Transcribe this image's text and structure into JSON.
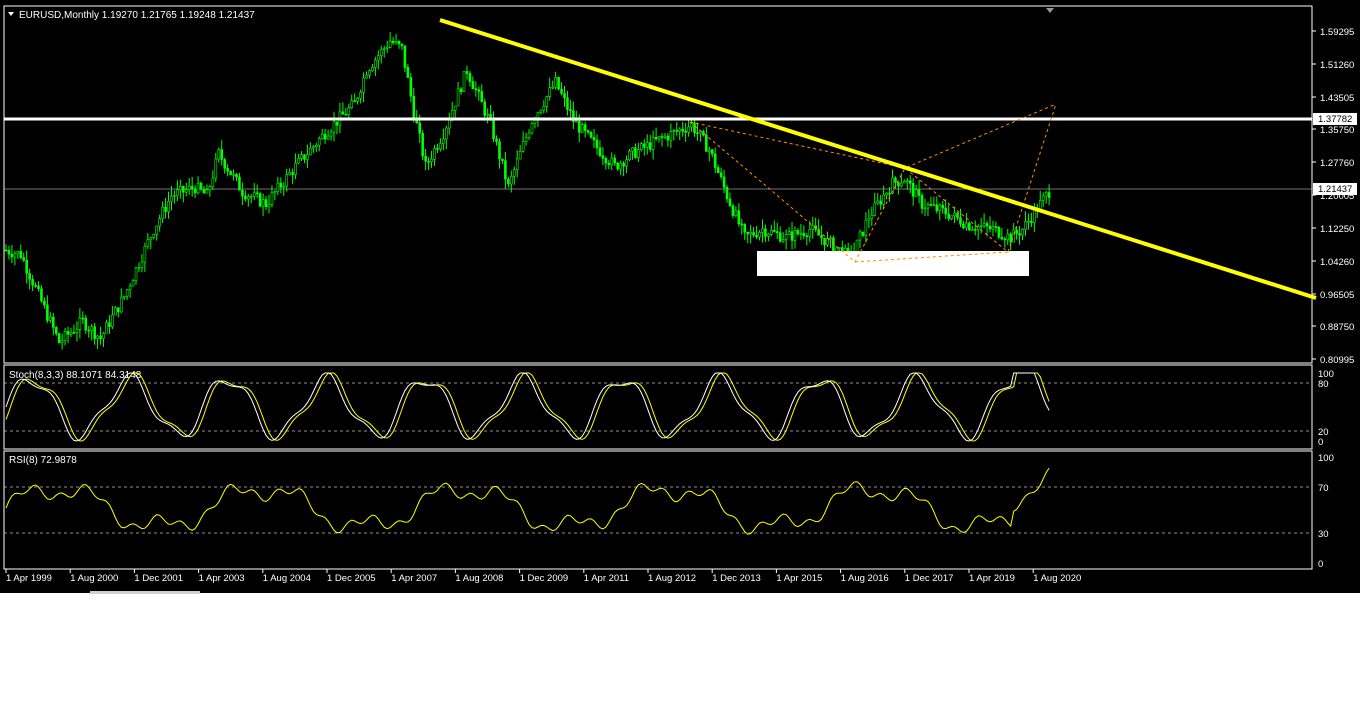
{
  "window": {
    "symbol_header": "EURUSD,Monthly  1.19270 1.21765 1.19248 1.21437",
    "dropdown_arrow": "triangle-down-icon"
  },
  "colors": {
    "background": "#000000",
    "candle": "#00ff00",
    "trendline": "#ffff00",
    "horizontal_level": "#ffffff",
    "stoch_main": "#ffffff",
    "stoch_signal": "#ffff00",
    "rsi_line": "#ffff00",
    "pattern_lines": "#ff8c00",
    "bid_line": "#9a9a9a",
    "zone_box": "#ffffff"
  },
  "price_panel": {
    "price_labels": [
      "1.59295",
      "1.51260",
      "1.43505",
      "1.35750",
      "1.27760",
      "1.20005",
      "1.12250",
      "1.04260",
      "0.96505",
      "0.88750",
      "0.80995"
    ],
    "current_price": "1.21437",
    "level_price": "1.37782"
  },
  "stoch_panel": {
    "header": "Stoch(8,3,3) 88.1071 84.3148",
    "levels": [
      "100",
      "80",
      "20",
      "0"
    ]
  },
  "rsi_panel": {
    "header": "RSI(8) 72.9878",
    "levels": [
      "100",
      "70",
      "30",
      "0"
    ]
  },
  "time_axis": {
    "labels": [
      "1 Apr 1999",
      "1 Aug 2000",
      "1 Dec 2001",
      "1 Apr 2003",
      "1 Aug 2004",
      "1 Dec 2005",
      "1 Apr 2007",
      "1 Aug 2008",
      "1 Dec 2009",
      "1 Apr 2011",
      "1 Aug 2012",
      "1 Dec 2013",
      "1 Apr 2015",
      "1 Aug 2016",
      "1 Dec 2017",
      "1 Apr 2019",
      "1 Aug 2020"
    ]
  },
  "chart_data": {
    "type": "candlestick",
    "symbol": "EURUSD",
    "timeframe": "Monthly",
    "ohlc_last": {
      "open": 1.1927,
      "high": 1.21765,
      "low": 1.19248,
      "close": 1.21437
    },
    "ylim": [
      0.80995,
      1.59295
    ],
    "approx_close_path": [
      {
        "date": "1999-04",
        "close": 1.07
      },
      {
        "date": "2000-10",
        "close": 0.85
      },
      {
        "date": "2001-12",
        "close": 0.89
      },
      {
        "date": "2003-05",
        "close": 1.17
      },
      {
        "date": "2004-12",
        "close": 1.36
      },
      {
        "date": "2005-11",
        "close": 1.17
      },
      {
        "date": "2006-12",
        "close": 1.32
      },
      {
        "date": "2008-04",
        "close": 1.58
      },
      {
        "date": "2008-11",
        "close": 1.27
      },
      {
        "date": "2009-11",
        "close": 1.5
      },
      {
        "date": "2010-06",
        "close": 1.22
      },
      {
        "date": "2011-04",
        "close": 1.48
      },
      {
        "date": "2012-07",
        "close": 1.23
      },
      {
        "date": "2014-04",
        "close": 1.38
      },
      {
        "date": "2015-03",
        "close": 1.08
      },
      {
        "date": "2016-12",
        "close": 1.05
      },
      {
        "date": "2018-01",
        "close": 1.25
      },
      {
        "date": "2020-02",
        "close": 1.1
      },
      {
        "date": "2020-12",
        "close": 1.21437
      }
    ],
    "annotations": {
      "descending_trendline": {
        "from": {
          "date": "2008-04",
          "price": 1.6
        },
        "to": {
          "date": "2020-12",
          "price": 1.19
        }
      },
      "horizontal_level": 1.37782,
      "support_zone": {
        "top": 1.065,
        "bottom": 1.03,
        "from": "2014-12",
        "to": "2020-04"
      }
    },
    "stochastic": {
      "k_period": 8,
      "d": 3,
      "slowing": 3,
      "main": 88.1071,
      "signal": 84.3148,
      "levels": [
        80,
        20
      ]
    },
    "rsi": {
      "period": 8,
      "value": 72.9878,
      "levels": [
        70,
        30
      ]
    }
  }
}
